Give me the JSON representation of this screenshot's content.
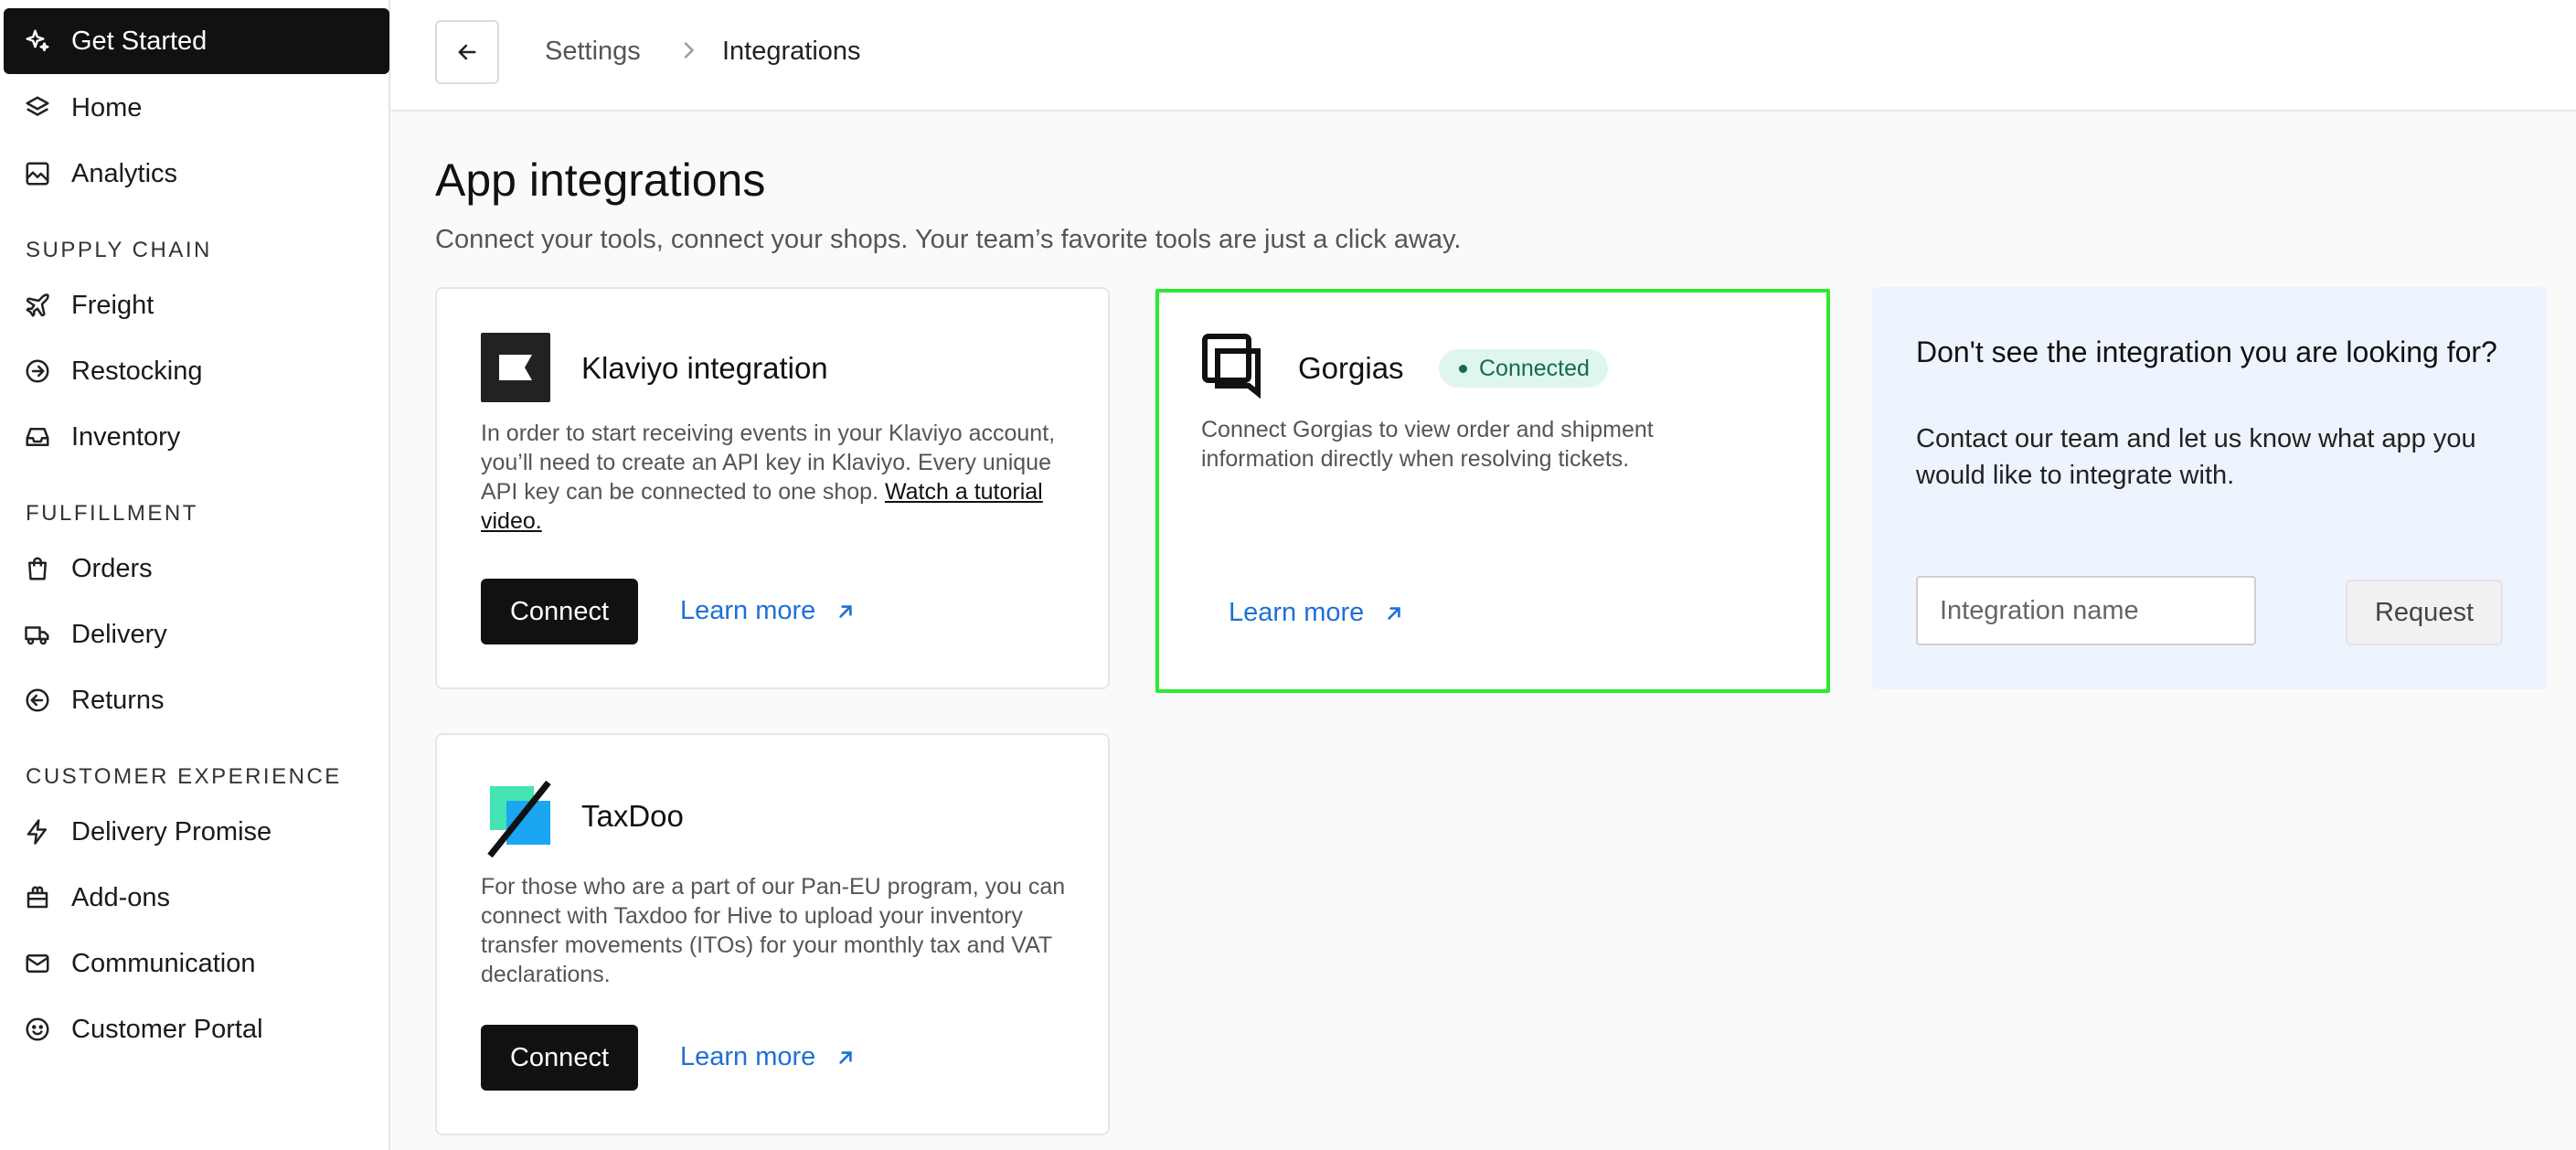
{
  "sidebar": {
    "items": [
      {
        "label": "Get Started",
        "icon": "sparkle-icon",
        "active": true
      },
      {
        "label": "Home",
        "icon": "layers-icon"
      },
      {
        "label": "Analytics",
        "icon": "chart-image-icon"
      }
    ],
    "sections": [
      {
        "title": "SUPPLY CHAIN",
        "items": [
          {
            "label": "Freight",
            "icon": "plane-icon"
          },
          {
            "label": "Restocking",
            "icon": "circle-arrow-right-icon"
          },
          {
            "label": "Inventory",
            "icon": "inbox-icon"
          }
        ]
      },
      {
        "title": "FULFILLMENT",
        "items": [
          {
            "label": "Orders",
            "icon": "shopping-bag-icon"
          },
          {
            "label": "Delivery",
            "icon": "truck-icon"
          },
          {
            "label": "Returns",
            "icon": "circle-arrow-left-icon"
          }
        ]
      },
      {
        "title": "CUSTOMER EXPERIENCE",
        "items": [
          {
            "label": "Delivery Promise",
            "icon": "lightning-icon"
          },
          {
            "label": "Add-ons",
            "icon": "gift-bag-icon"
          },
          {
            "label": "Communication",
            "icon": "mail-icon"
          },
          {
            "label": "Customer Portal",
            "icon": "smiley-icon"
          }
        ]
      }
    ]
  },
  "topbar": {
    "breadcrumb": [
      "Settings",
      "Integrations"
    ]
  },
  "main": {
    "title": "App integrations",
    "subtitle": "Connect your tools, connect your shops. Your team’s favorite tools are just a click away.",
    "cards": {
      "klaviyo": {
        "title": "Klaviyo integration",
        "description": "In order to start receiving events in your Klaviyo account, you’ll need to create an API key in Klaviyo. Every unique API key can be connected to one shop.",
        "tutorial_link": "Watch a tutorial video.",
        "connect_label": "Connect",
        "learn_more_label": "Learn more"
      },
      "gorgias": {
        "title": "Gorgias",
        "status": "Connected",
        "description": "Connect Gorgias to view order and shipment information directly when resolving tickets.",
        "learn_more_label": "Learn more"
      },
      "taxdoo": {
        "title": "TaxDoo",
        "description": "For those who are a part of our Pan-EU program, you can connect with Taxdoo for Hive to upload your inventory transfer movements (ITOs) for your monthly tax and VAT declarations.",
        "connect_label": "Connect",
        "learn_more_label": "Learn more"
      }
    },
    "request": {
      "title": "Don't see the integration you are looking for?",
      "subtitle": "Contact our team and let us know what app you would like to integrate with.",
      "input_placeholder": "Integration name",
      "input_value": "",
      "button_label": "Request"
    }
  },
  "colors": {
    "active_nav_bg": "#111111",
    "link": "#1f6fd6",
    "highlight_border": "#2ee82e",
    "badge_bg": "#dff6ee",
    "badge_text": "#146b4a",
    "request_panel_bg": "#edf4fd"
  }
}
